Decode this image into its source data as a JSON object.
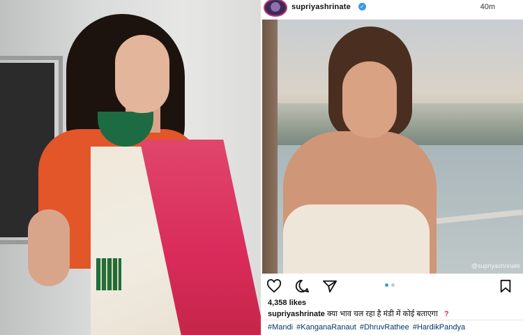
{
  "post": {
    "username": "supriyashrinate",
    "timestamp": "40m",
    "likes": "4,358 likes",
    "caption_user": "supriyashrinate",
    "caption_text": "क्या भाव चल रहा है मंडी में कोई बताएगा",
    "caption_mark": "?",
    "hashtags": [
      "#Mandi",
      "#KanganaRanaut",
      "#DhruvRathee",
      "#HardikPandya"
    ],
    "image_watermark": "@supriyashrinate",
    "carousel": {
      "current": 1,
      "total": 2
    }
  },
  "icons": {
    "verified": "verified-badge-icon",
    "like": "heart-icon",
    "comment": "comment-icon",
    "share": "send-icon",
    "save": "bookmark-icon"
  },
  "colors": {
    "verified": "#3897f0",
    "hashtag": "#00376b",
    "caption_mark": "#d93025",
    "carousel_active": "#3897f0"
  }
}
